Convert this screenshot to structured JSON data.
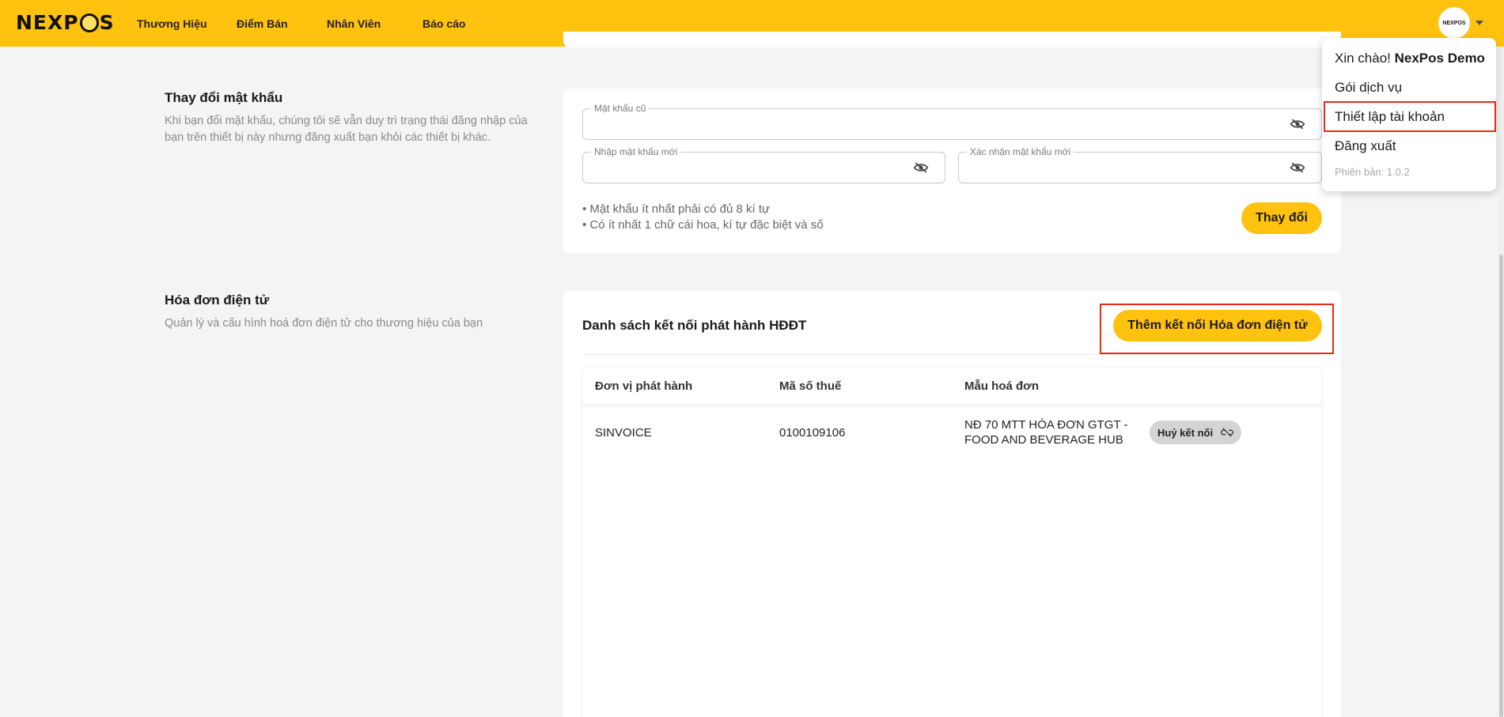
{
  "header": {
    "logo_text_left": "NEXP",
    "logo_text_right": "S",
    "nav": [
      "Thương Hiệu",
      "Điểm Bán",
      "Nhân Viên",
      "Báo cáo"
    ],
    "avatar_text": "NEXPOS"
  },
  "password_section": {
    "title": "Thay đổi mật khẩu",
    "description": "Khi bạn đổi mật khẩu, chúng tôi sẽ vẫn duy trì trạng thái đăng nhập của bạn trên thiết bị này nhưng đăng xuất bạn khỏi các thiết bị khác.",
    "old_password_label": "Mật khẩu cũ",
    "new_password_label": "Nhập mật khẩu mới",
    "confirm_password_label": "Xác nhận mật khẩu mới",
    "hint_1": "• Mật khẩu ít nhất phải có đủ 8 kí tự",
    "hint_2": "• Có ít nhất 1 chữ cái hoa, kí tự đặc biệt và số",
    "submit_label": "Thay đổi"
  },
  "invoice_section": {
    "title": "Hóa đơn điện tử",
    "description": "Quản lý và cấu hình hoá đơn điện tử cho thương hiệu của bạn",
    "list_title": "Danh sách kết nối phát hành HĐĐT",
    "add_button_label": "Thêm kết nối Hóa đơn điện tử",
    "columns": [
      "Đơn vị phát hành",
      "Mã số thuế",
      "Mẫu hoá đơn"
    ],
    "rows": [
      {
        "issuer": "SINVOICE",
        "tax_code": "0100109106",
        "template_line1": "NĐ 70 MTT HÓA ĐƠN GTGT -",
        "template_line2": "FOOD AND BEVERAGE HUB",
        "action_label": "Huỷ kết nối"
      }
    ]
  },
  "user_menu": {
    "greeting_prefix": "Xin chào!",
    "user_name": "NexPos Demo",
    "items": [
      "Gói dịch vụ",
      "Thiết lập tài khoản",
      "Đăng xuất"
    ],
    "version": "Phiên bản: 1.0.2"
  },
  "colors": {
    "brand_yellow": "#ffc20e",
    "highlight_red": "#e8291c"
  }
}
